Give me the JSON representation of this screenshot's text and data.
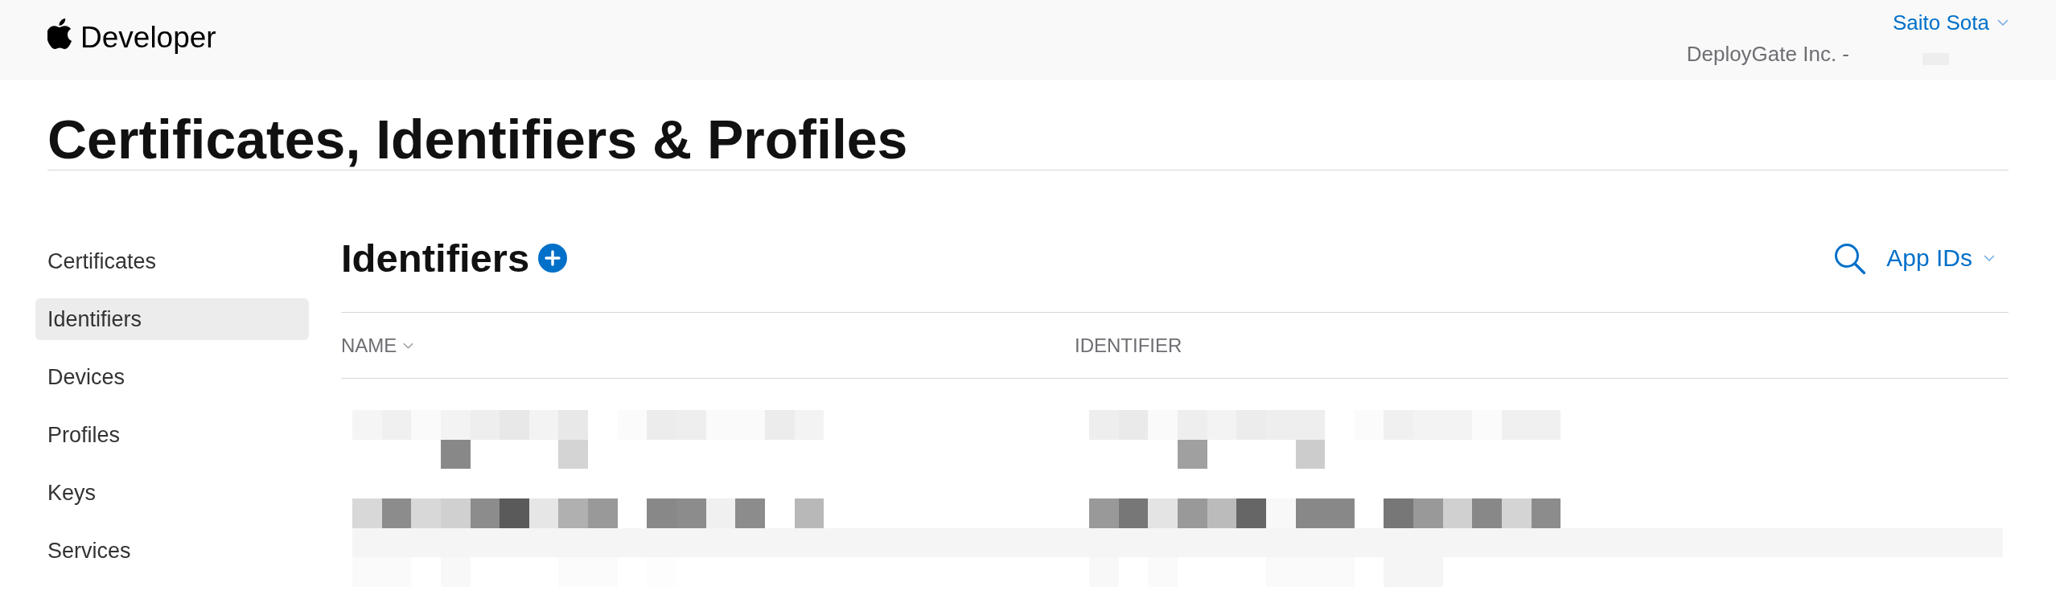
{
  "header": {
    "logo_text": "Developer",
    "account": {
      "name": "Saito Sota"
    },
    "team": "DeployGate Inc. -"
  },
  "page_title": "Certificates, Identifiers & Profiles",
  "sidebar": {
    "items": [
      {
        "label": "Certificates",
        "selected": false
      },
      {
        "label": "Identifiers",
        "selected": true
      },
      {
        "label": "Devices",
        "selected": false
      },
      {
        "label": "Profiles",
        "selected": false
      },
      {
        "label": "Keys",
        "selected": false
      },
      {
        "label": "Services",
        "selected": false
      }
    ]
  },
  "section": {
    "title": "Identifiers",
    "filter": "App IDs"
  },
  "table": {
    "columns": [
      {
        "label": "NAME",
        "sorted": true
      },
      {
        "label": "IDENTIFIER",
        "sorted": false
      }
    ]
  }
}
